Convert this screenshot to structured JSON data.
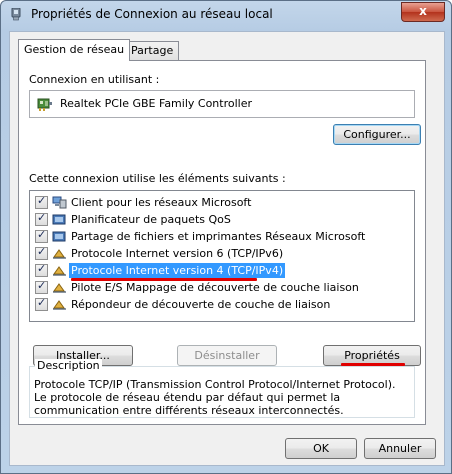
{
  "window": {
    "title": "Propriétés de Connexion au réseau local",
    "close_glyph": "x"
  },
  "tabs": [
    {
      "label": "Gestion de réseau"
    },
    {
      "label": "Partage"
    }
  ],
  "connect": {
    "label": "Connexion en utilisant :",
    "adapter": "Realtek PCIe GBE Family Controller",
    "configure_label": "Configurer..."
  },
  "components": {
    "label": "Cette connexion utilise les éléments suivants :",
    "items": [
      {
        "label": "Client pour les réseaux Microsoft",
        "checked": true,
        "icon": "network-client-icon"
      },
      {
        "label": "Planificateur de paquets QoS",
        "checked": true,
        "icon": "network-service-icon"
      },
      {
        "label": "Partage de fichiers et imprimantes Réseaux Microsoft",
        "checked": true,
        "icon": "network-service-icon"
      },
      {
        "label": "Protocole Internet version 6 (TCP/IPv6)",
        "checked": true,
        "icon": "protocol-icon"
      },
      {
        "label": "Protocole Internet version 4 (TCP/IPv4)",
        "checked": true,
        "icon": "protocol-icon",
        "selected": true
      },
      {
        "label": "Pilote E/S Mappage de découverte de couche liaison",
        "checked": true,
        "icon": "protocol-icon"
      },
      {
        "label": "Répondeur de découverte de couche de liaison",
        "checked": true,
        "icon": "protocol-icon"
      }
    ]
  },
  "buttons": {
    "install": "Installer...",
    "uninstall": "Désinstaller",
    "properties": "Propriétés",
    "ok": "OK",
    "cancel": "Annuler"
  },
  "description": {
    "legend": "Description",
    "text": "Protocole TCP/IP (Transmission Control Protocol/Internet Protocol). Le protocole de réseau étendu par défaut qui permet la communication entre différents réseaux interconnectés."
  },
  "colors": {
    "selection": "#3399ff",
    "annotation_underline": "#e00000",
    "close_button": "#c9543e"
  }
}
